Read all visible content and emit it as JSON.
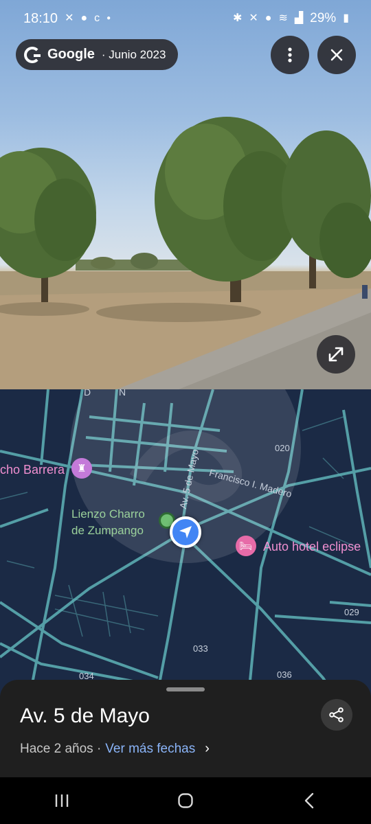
{
  "status_bar": {
    "time": "18:10",
    "battery": "29%",
    "left_icons": [
      "missed-call-icon",
      "message-icon",
      "app-c-icon",
      "dot-icon"
    ],
    "right_icons": [
      "bluetooth-icon",
      "mute-icon",
      "location-icon",
      "wifi-icon",
      "signal-icon",
      "battery-icon"
    ]
  },
  "header": {
    "brand": "Google",
    "date": "· Junio 2023"
  },
  "map": {
    "places": {
      "barrera": "cho Barrera",
      "lienzo_line1": "Lienzo Charro",
      "lienzo_line2": "de Zumpango",
      "hotel": "Auto hotel eclipse"
    },
    "streets": {
      "av5": "Av. 5 de Mayo",
      "madero": "Francisco I. Madero"
    },
    "numbers": {
      "n020": "020",
      "n029": "029",
      "n033": "033",
      "n034": "034",
      "n036": "036"
    }
  },
  "sheet": {
    "title": "Av. 5 de Mayo",
    "age": "Hace 2 años ·",
    "more_dates": "Ver más fechas"
  },
  "colors": {
    "map_bg": "#1b2a45",
    "road": "#5fb3b8",
    "link": "#8ab4f8",
    "marker": "#4285f4"
  }
}
